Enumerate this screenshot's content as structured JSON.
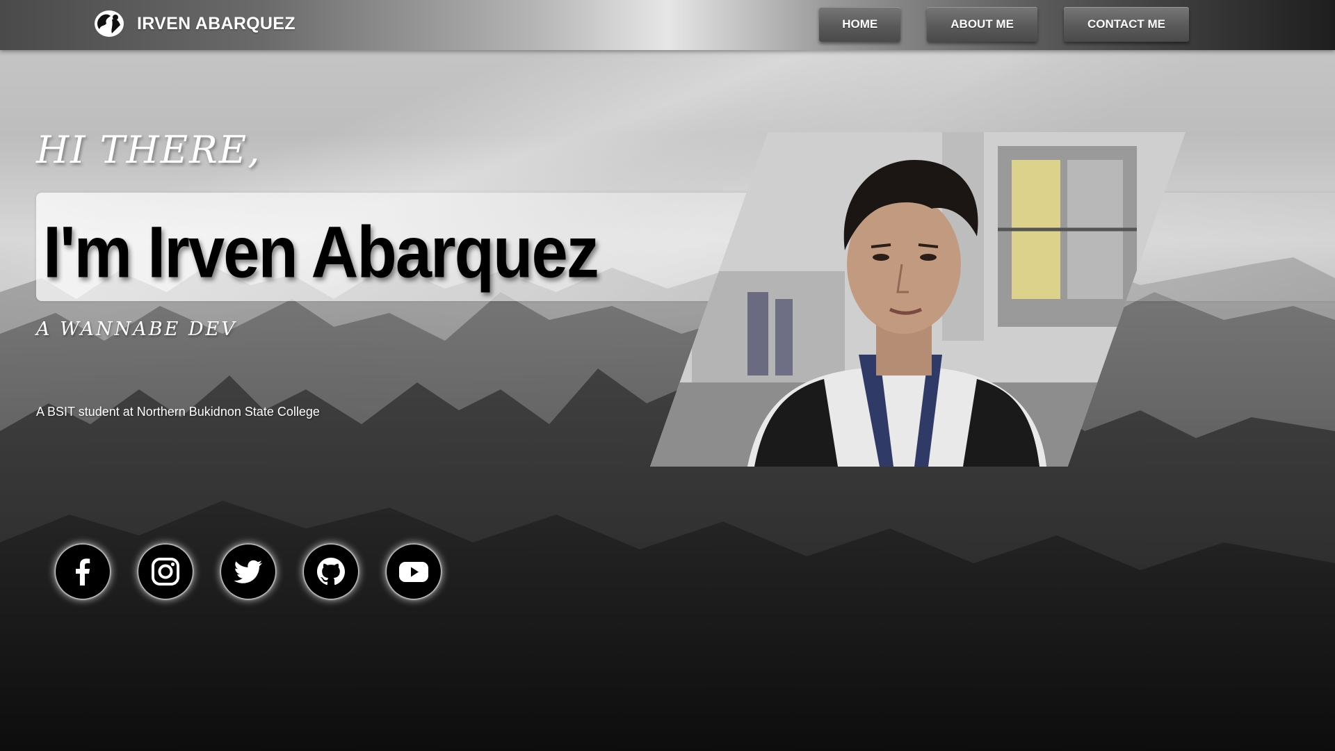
{
  "header": {
    "brand_name": "IRVEN ABARQUEZ",
    "logo_icon": "globe-logo-icon",
    "nav": [
      {
        "label": "HOME"
      },
      {
        "label": "ABOUT ME"
      },
      {
        "label": "CONTACT ME"
      }
    ]
  },
  "hero": {
    "greeting": "HI THERE,",
    "name": "I'm Irven Abarquez",
    "tagline": "A WANNABE DEV",
    "description": "A BSIT student at Northern Bukidnon State College"
  },
  "photo": {
    "icon": "profile-photo"
  },
  "socials": [
    {
      "icon": "facebook-icon"
    },
    {
      "icon": "instagram-icon"
    },
    {
      "icon": "twitter-icon"
    },
    {
      "icon": "github-icon"
    },
    {
      "icon": "youtube-icon"
    }
  ],
  "colors": {
    "text_primary": "#ffffff",
    "name_text": "#000000",
    "nav_button": "#5a5a5a"
  }
}
